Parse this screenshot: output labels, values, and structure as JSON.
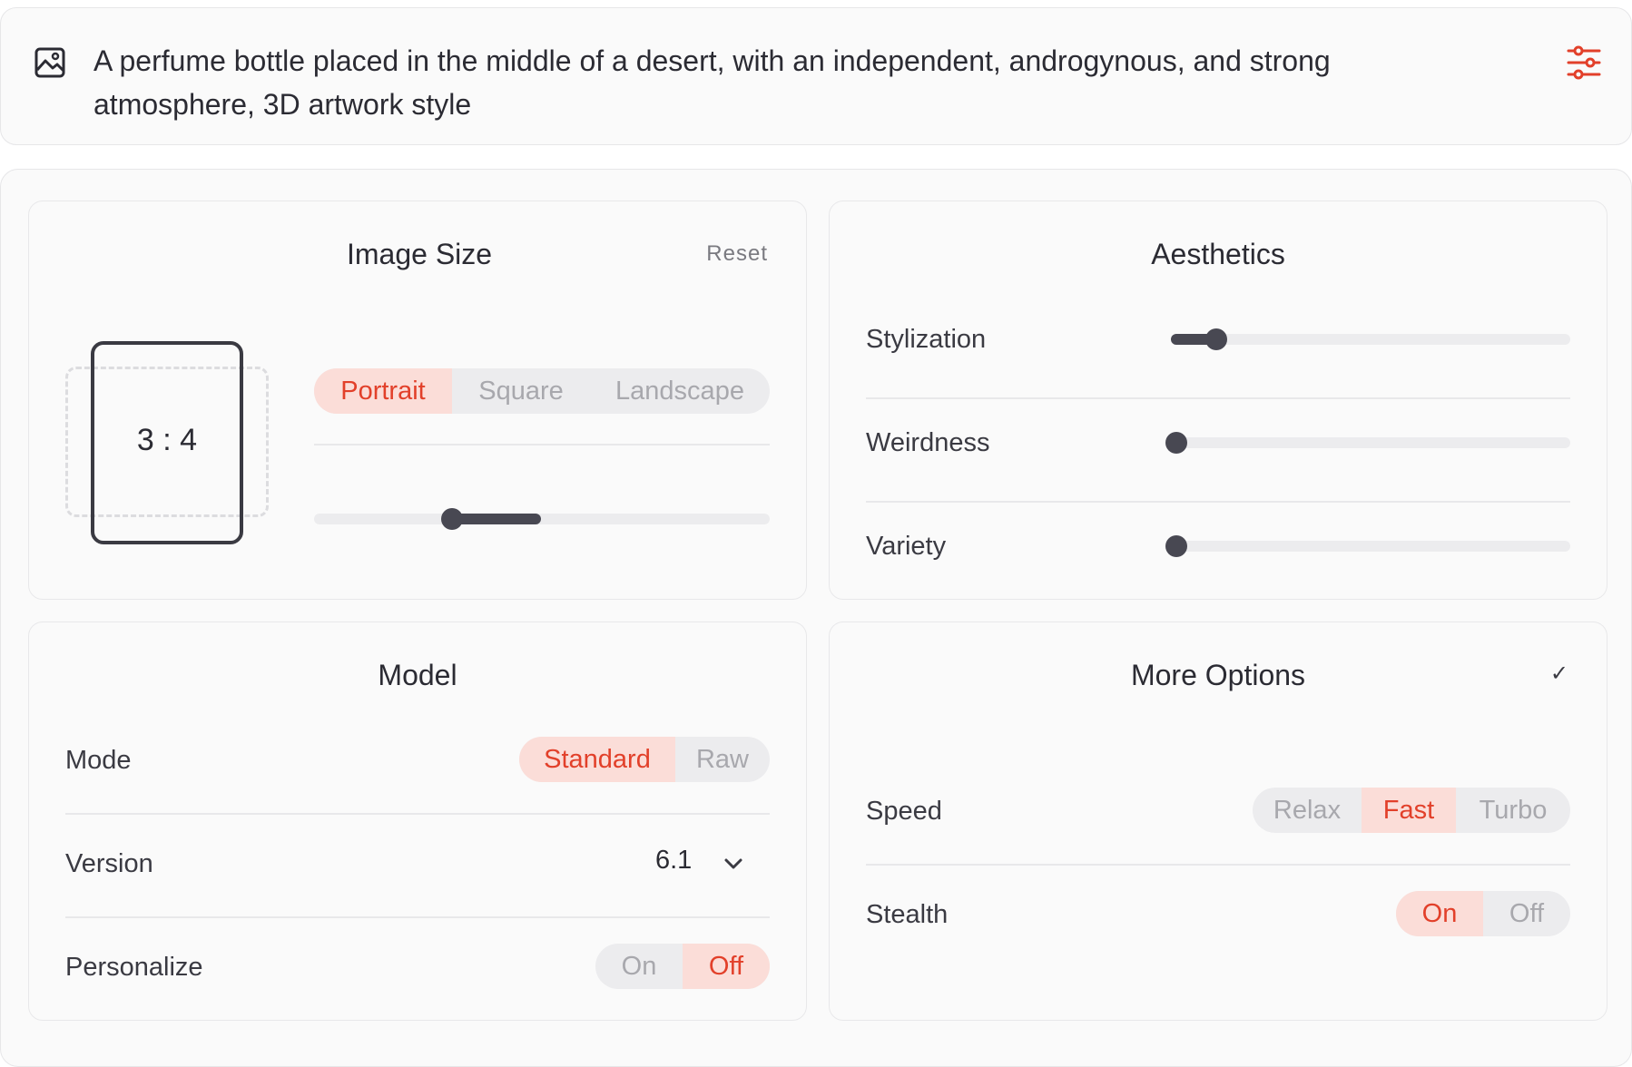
{
  "prompt": {
    "line1": "A perfume bottle placed in the middle of a desert, with an independent, androgynous, and strong",
    "line2": "atmosphere, 3D artwork style"
  },
  "image_size": {
    "title": "Image Size",
    "reset_label": "Reset",
    "ratio": "3 : 4",
    "orientations": [
      "Portrait",
      "Square",
      "Landscape"
    ],
    "selected_orientation": "Portrait"
  },
  "aesthetics": {
    "title": "Aesthetics",
    "sliders": [
      {
        "label": "Stylization",
        "value": 0.11
      },
      {
        "label": "Weirdness",
        "value": 0.0
      },
      {
        "label": "Variety",
        "value": 0.0
      }
    ]
  },
  "model": {
    "title": "Model",
    "mode_label": "Mode",
    "modes": [
      "Standard",
      "Raw"
    ],
    "selected_mode": "Standard",
    "version_label": "Version",
    "version_value": "6.1",
    "personalize_label": "Personalize",
    "personalize_options": [
      "On",
      "Off"
    ],
    "personalize_selected": "Off"
  },
  "more_options": {
    "title": "More Options",
    "check_glyph": "✓",
    "speed_label": "Speed",
    "speeds": [
      "Relax",
      "Fast",
      "Turbo"
    ],
    "speed_selected": "Fast",
    "stealth_label": "Stealth",
    "stealth_options": [
      "On",
      "Off"
    ],
    "stealth_selected": "On"
  },
  "colors": {
    "accent": "#e2402a",
    "accent_bg": "#fbddd8",
    "slider": "#484852",
    "track": "#ececee"
  }
}
